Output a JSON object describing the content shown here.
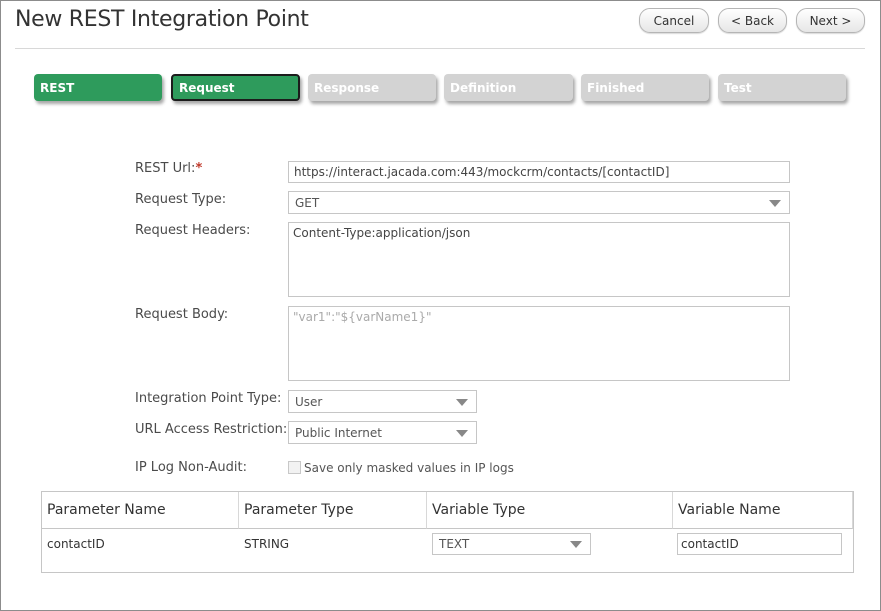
{
  "window": {
    "title": "New REST Integration Point"
  },
  "toolbar": {
    "cancel_label": "Cancel",
    "back_label": "< Back",
    "next_label": "Next >"
  },
  "steps": [
    {
      "label": "REST",
      "state": "done"
    },
    {
      "label": "Request",
      "state": "active"
    },
    {
      "label": "Response",
      "state": "todo"
    },
    {
      "label": "Definition",
      "state": "todo"
    },
    {
      "label": "Finished",
      "state": "todo"
    },
    {
      "label": "Test",
      "state": "todo"
    }
  ],
  "form": {
    "rest_url_label": "REST Url:",
    "required_mark": "*",
    "rest_url_value": "https://interact.jacada.com:443/mockcrm/contacts/[contactID]",
    "request_type_label": "Request Type:",
    "request_type_value": "GET",
    "request_headers_label": "Request Headers:",
    "request_headers_value": "Content-Type:application/json",
    "request_body_label": "Request Body:",
    "request_body_placeholder": "\"var1\":\"${varName1}\"",
    "ip_type_label": "Integration Point Type:",
    "ip_type_value": "User",
    "url_access_label": "URL Access Restriction:",
    "url_access_value": "Public Internet",
    "ip_log_label": "IP Log Non-Audit:",
    "ip_log_checkbox_label": "Save only masked values in IP logs",
    "ip_log_checked": false
  },
  "params_table": {
    "headers": [
      "Parameter Name",
      "Parameter Type",
      "Variable Type",
      "Variable Name"
    ],
    "rows": [
      {
        "name": "contactID",
        "type": "STRING",
        "variable_type": "TEXT",
        "variable_name": "contactID"
      }
    ]
  },
  "colors": {
    "accent": "#2e9b5c",
    "inactive_step": "#d3d3d3",
    "required": "#c0392b"
  }
}
